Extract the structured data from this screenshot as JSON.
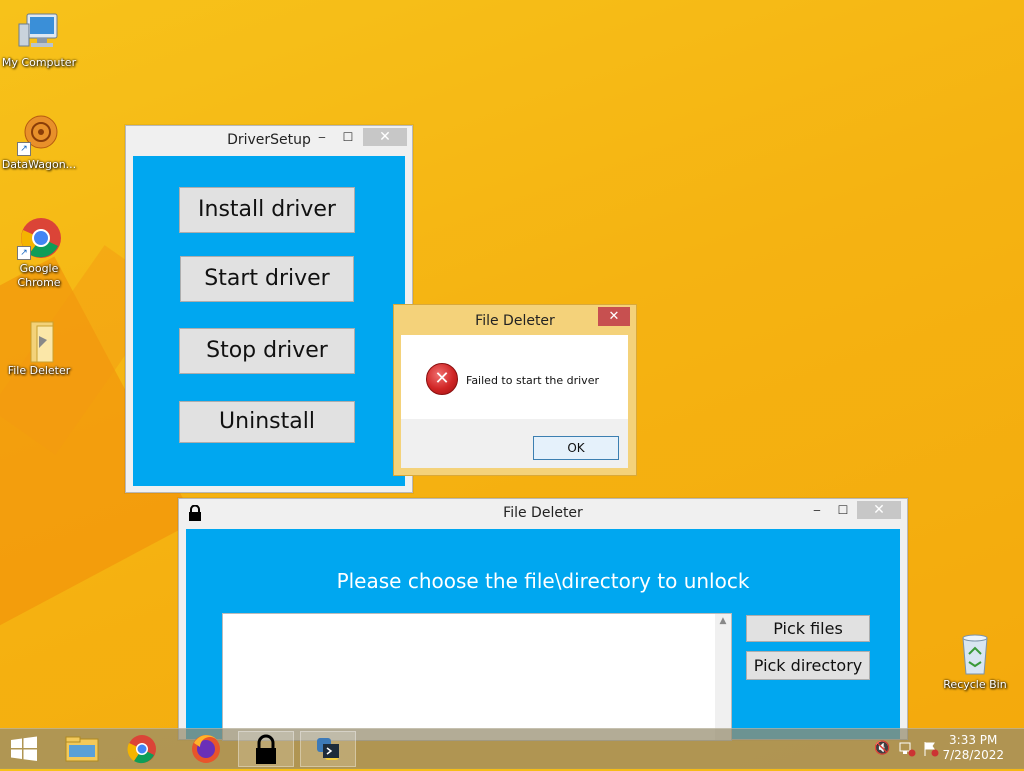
{
  "desktop": {
    "icons": [
      {
        "label": "My Computer"
      },
      {
        "label": "DataWagon..."
      },
      {
        "label": "Google Chrome"
      },
      {
        "label": "File Deleter"
      },
      {
        "label": "Recycle Bin"
      }
    ]
  },
  "driver_setup": {
    "title": "DriverSetup",
    "buttons": {
      "install": "Install driver",
      "start": "Start driver",
      "stop": "Stop driver",
      "uninstall": "Uninstall"
    }
  },
  "dialog": {
    "title": "File Deleter",
    "message": "Failed to start the driver",
    "ok": "OK",
    "close": "✕"
  },
  "file_deleter": {
    "title": "File Deleter",
    "heading": "Please choose the file\\directory to unlock",
    "pick_files": "Pick files",
    "pick_directory": "Pick directory"
  },
  "window_controls": {
    "minimize": "‒",
    "maximize": "☐",
    "close": "✕"
  },
  "taskbar": {
    "time": "3:33 PM",
    "date": "7/28/2022"
  }
}
